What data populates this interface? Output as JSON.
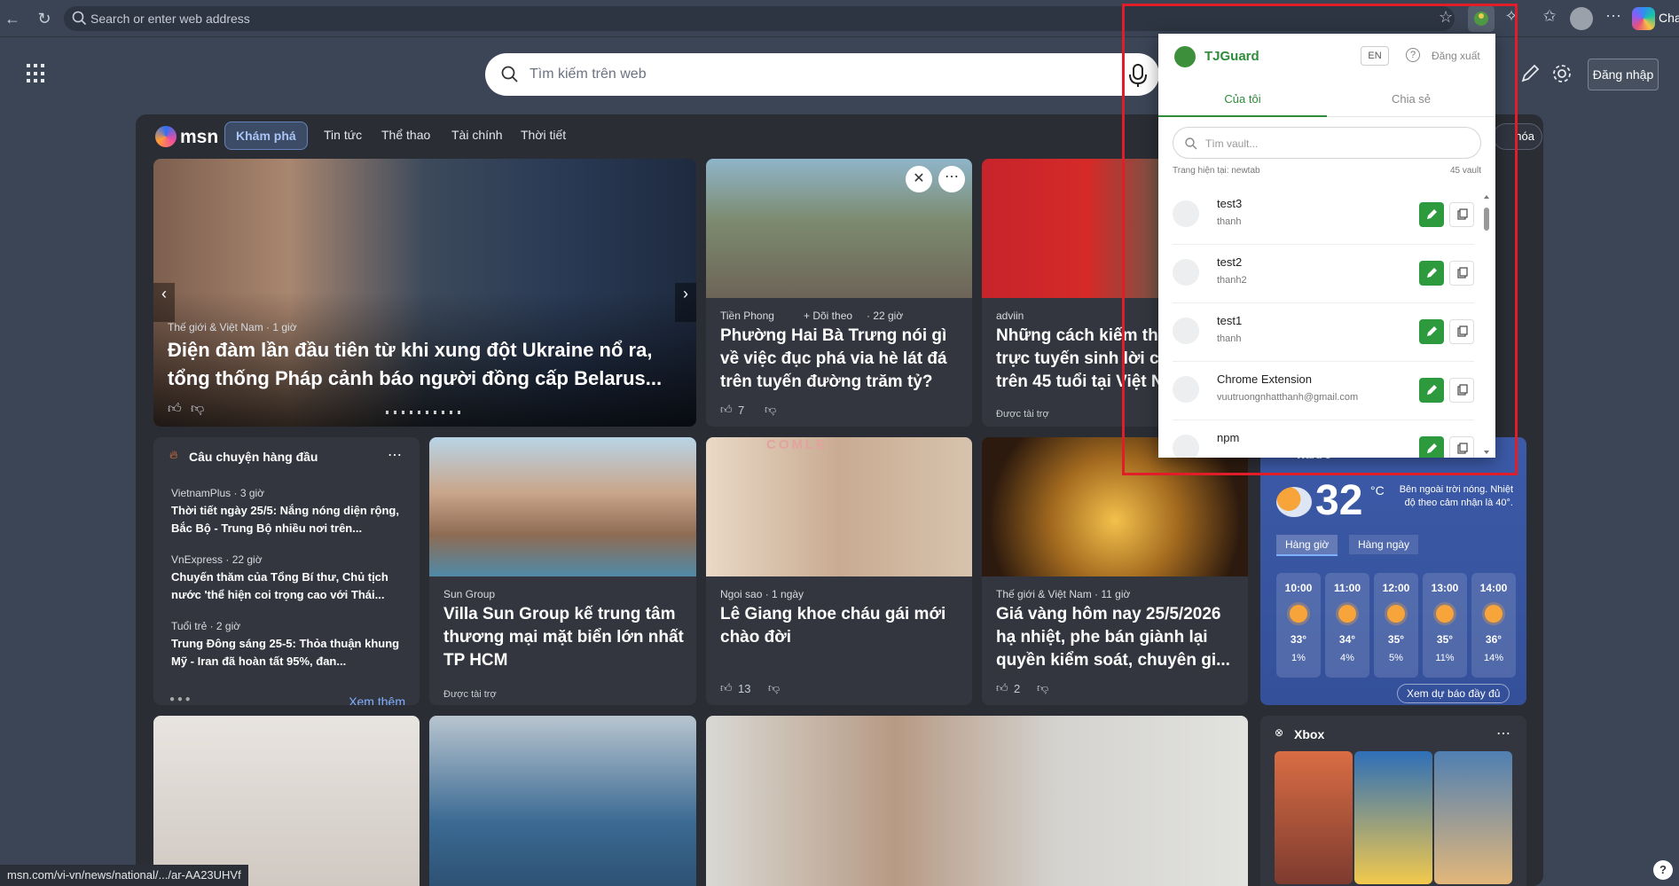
{
  "browser": {
    "address_placeholder": "Search or enter web address",
    "profile_label": "Cha",
    "status_url": "msn.com/vi-vn/news/national/.../ar-AA23UHVf"
  },
  "msn": {
    "search_placeholder": "Tìm kiếm trên web",
    "signin": "Đăng nhập",
    "nav": [
      "Khám phá",
      "Tin tức",
      "Thể thao",
      "Tài chính",
      "Thời tiết"
    ],
    "right_pill": "hóa"
  },
  "hero": {
    "source": "Thế giới & Việt Nam · 1 giờ",
    "title": "Điện đàm lần đầu tiên từ khi xung đột Ukraine nổ ra, tổng thống Pháp cảnh báo người đồng cấp Belarus..."
  },
  "card_hbt": {
    "source": "Tiền Phong",
    "follow": "+ Dõi theo",
    "time": "· 22 giờ",
    "title": "Phường Hai Bà Trưng nói gì về việc đục phá via hè lát đá trên tuyến đường trăm tỷ?",
    "likes": "7"
  },
  "card_ad": {
    "source": "adviin",
    "title": "Những cách kiếm thu nhập trực tuyến sinh lời cho người trên 45 tuổi tại Việt Nam",
    "sponsored": "Được tài trợ"
  },
  "top_stories": {
    "heading": "Câu chuyện hàng đầu",
    "items": [
      {
        "source": "VietnamPlus · 3 giờ",
        "text": "Thời tiết ngày 25/5: Nắng nóng diện rộng, Bắc Bộ - Trung Bộ nhiều nơi trên..."
      },
      {
        "source": "VnExpress · 22 giờ",
        "text": "Chuyến thăm của Tổng Bí thư, Chủ tịch nước 'thể hiện coi trọng cao với Thái..."
      },
      {
        "source": "Tuổi trẻ · 2 giờ",
        "text": "Trung Đông sáng 25-5: Thỏa thuận khung Mỹ - Iran đã hoàn tất 95%, đan..."
      }
    ],
    "see_more": "Xem thêm"
  },
  "card_sun": {
    "source": "Sun Group",
    "title": "Villa Sun Group kế trung tâm thương mại mặt biển lớn nhất TP HCM",
    "sponsored": "Được tài trợ"
  },
  "card_lg": {
    "source": "Ngoi sao · 1 ngày",
    "title": "Lê Giang khoe cháu gái mới chào đời",
    "likes": "13",
    "image_text": "COMLE"
  },
  "card_gold": {
    "source": "Thế giới & Việt Nam · 11 giờ",
    "title": "Giá vàng hôm nay 25/5/2026 hạ nhiệt, phe bán giành lại quyền kiểm soát, chuyên gi...",
    "likes": "2"
  },
  "weather": {
    "location": "Ward 5",
    "temp": "32",
    "unit": "°C",
    "note": "Bên ngoài trời nóng. Nhiệt độ theo cảm nhận là 40°.",
    "tabs": [
      "Hàng giờ",
      "Hàng ngày"
    ],
    "hours": [
      {
        "time": "10:00",
        "temp": "33°",
        "rain": "1%"
      },
      {
        "time": "11:00",
        "temp": "34°",
        "rain": "4%"
      },
      {
        "time": "12:00",
        "temp": "35°",
        "rain": "5%"
      },
      {
        "time": "13:00",
        "temp": "35°",
        "rain": "11%"
      },
      {
        "time": "14:00",
        "temp": "36°",
        "rain": "14%"
      }
    ],
    "full_forecast": "Xem dự báo đầy đủ"
  },
  "xbox": {
    "title": "Xbox"
  },
  "popup": {
    "app_name": "TJGuard",
    "lang": "EN",
    "logout": "Đăng xuất",
    "tabs": [
      "Của tôi",
      "Chia sẻ"
    ],
    "search_placeholder": "Tìm vault...",
    "page_label": "Trang hiện tại: newtab",
    "vault_count": "45 vault",
    "vaults": [
      {
        "name": "test3",
        "user": "thanh"
      },
      {
        "name": "test2",
        "user": "thanh2"
      },
      {
        "name": "test1",
        "user": "thanh"
      },
      {
        "name": "Chrome Extension",
        "user": "vuutruongnhatthanh@gmail.com"
      },
      {
        "name": "npm",
        "user": ""
      }
    ]
  }
}
